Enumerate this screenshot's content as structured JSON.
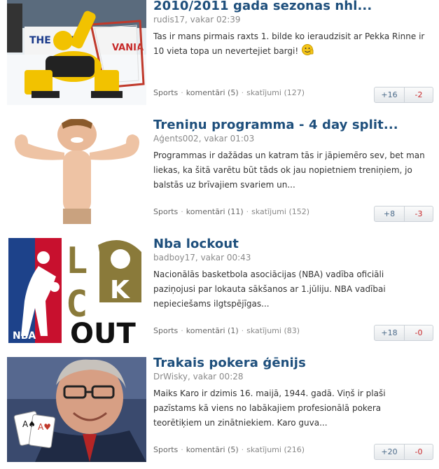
{
  "posts": [
    {
      "title": "2010/2011 gada sezonas nhl...",
      "author": "rudis17",
      "time": "vakar 02:39",
      "excerpt": "Tas ir mans pirmais raxts 1. bilde ko ieraudzisit ar Pekka Rinne ir 10 vieta topa un nevertejiet bargi!",
      "emoticon": "thumbs-up-smiley-icon",
      "category": "Sports",
      "comments": "komentāri (5)",
      "views": "skatījumi (127)",
      "up": "+16",
      "down": "-2",
      "thumb_text": "THE LOT",
      "thumb_text2": "VANIA"
    },
    {
      "title": "Treniņu programma - 4 day split...",
      "author": "Aģents002",
      "time": "vakar 01:03",
      "excerpt": "Programmas ir dažādas un katram tās ir jāpiemēro sev, bet man liekas, ka šitā varētu būt tāds ok jau nopietniem treniņiem, jo balstās uz brīvajiem svariem un...",
      "category": "Sports",
      "comments": "komentāri (11)",
      "views": "skatījumi (152)",
      "up": "+8",
      "down": "-3"
    },
    {
      "title": "Nba lockout",
      "author": "badboy17",
      "time": "vakar 00:43",
      "excerpt": "Nacionālās basketbola asociācijas (NBA) vadība oficiāli paziņojusi par lokauta sākšanos ar 1.jūliju. NBA vadībai nepieciešams ilgtspējīgas...",
      "category": "Sports",
      "comments": "komentāri (1)",
      "views": "skatījumi (83)",
      "up": "+18",
      "down": "-0",
      "thumb_logo": "NBA",
      "thumb_l": "L",
      "thumb_c": "C",
      "thumb_k": "K",
      "thumb_out": "OUT"
    },
    {
      "title": "Trakais pokera ģēnijs",
      "author": "DrWisky",
      "time": "vakar 00:28",
      "excerpt": "Maiks Karo ir dzimis 16. maijā, 1944. gadā. Viņš ir plaši pazīstams kā viens no labākajiem profesionālā pokera teorētiķiem un zinātniekiem. Karo guva...",
      "category": "Sports",
      "comments": "komentāri (5)",
      "views": "skatījumi (216)",
      "up": "+20",
      "down": "-0"
    }
  ],
  "colors": {
    "title": "#1e4f7c",
    "up": "#4c6b8a",
    "down": "#c8282b",
    "nba_red": "#c8102e",
    "nba_blue": "#1d428a",
    "lockout_gold": "#8a7a3a"
  }
}
